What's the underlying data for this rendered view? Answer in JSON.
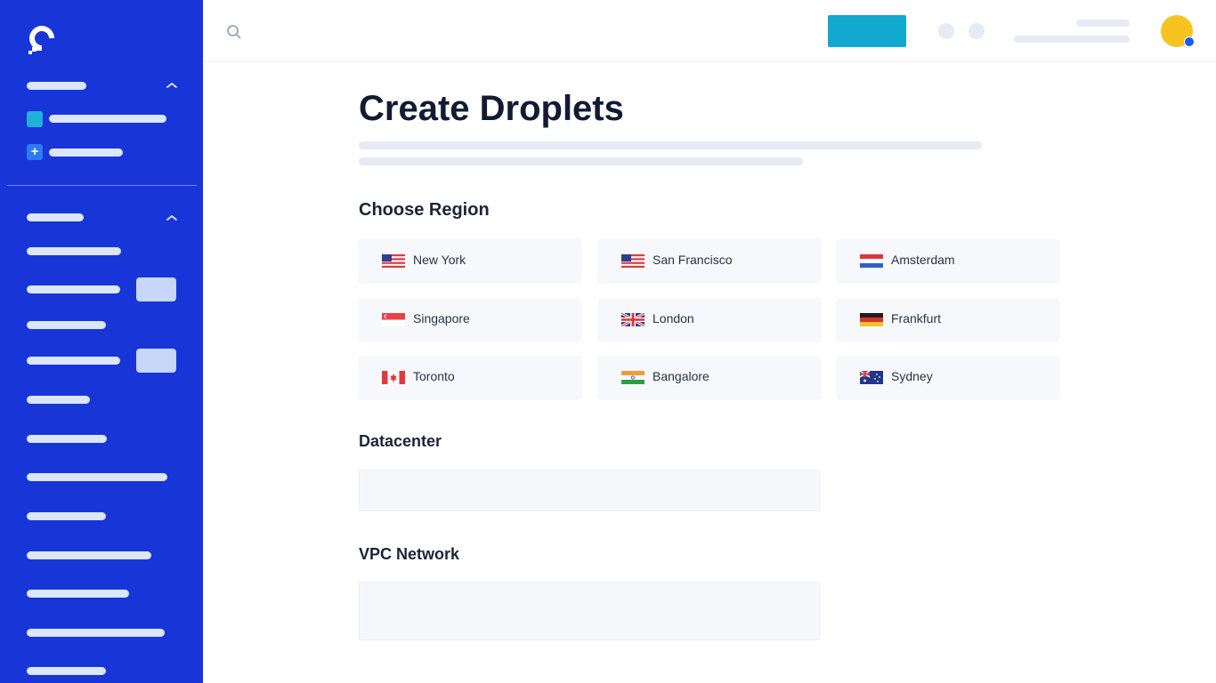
{
  "app": {
    "logo_icon": "digitalocean-logo-icon",
    "brand_color": "#1836d8",
    "accent_color": "#11a9cf"
  },
  "topbar": {
    "search_icon": "search-icon",
    "create_button_color": "#11a9cf",
    "avatar_color": "#f7c31f",
    "avatar_status_color": "#1a5cf5"
  },
  "main": {
    "title": "Create Droplets",
    "sections": {
      "region": {
        "heading": "Choose Region",
        "regions": [
          {
            "label": "New York",
            "flag": "us-flag-icon"
          },
          {
            "label": "San Francisco",
            "flag": "us-flag-icon"
          },
          {
            "label": "Amsterdam",
            "flag": "netherlands-flag-icon"
          },
          {
            "label": "Singapore",
            "flag": "singapore-flag-icon"
          },
          {
            "label": "London",
            "flag": "uk-flag-icon"
          },
          {
            "label": "Frankfurt",
            "flag": "germany-flag-icon"
          },
          {
            "label": "Toronto",
            "flag": "canada-flag-icon"
          },
          {
            "label": "Bangalore",
            "flag": "india-flag-icon"
          },
          {
            "label": "Sydney",
            "flag": "australia-flag-icon"
          }
        ]
      },
      "datacenter": {
        "heading": "Datacenter"
      },
      "vpc": {
        "heading": "VPC Network"
      }
    }
  }
}
